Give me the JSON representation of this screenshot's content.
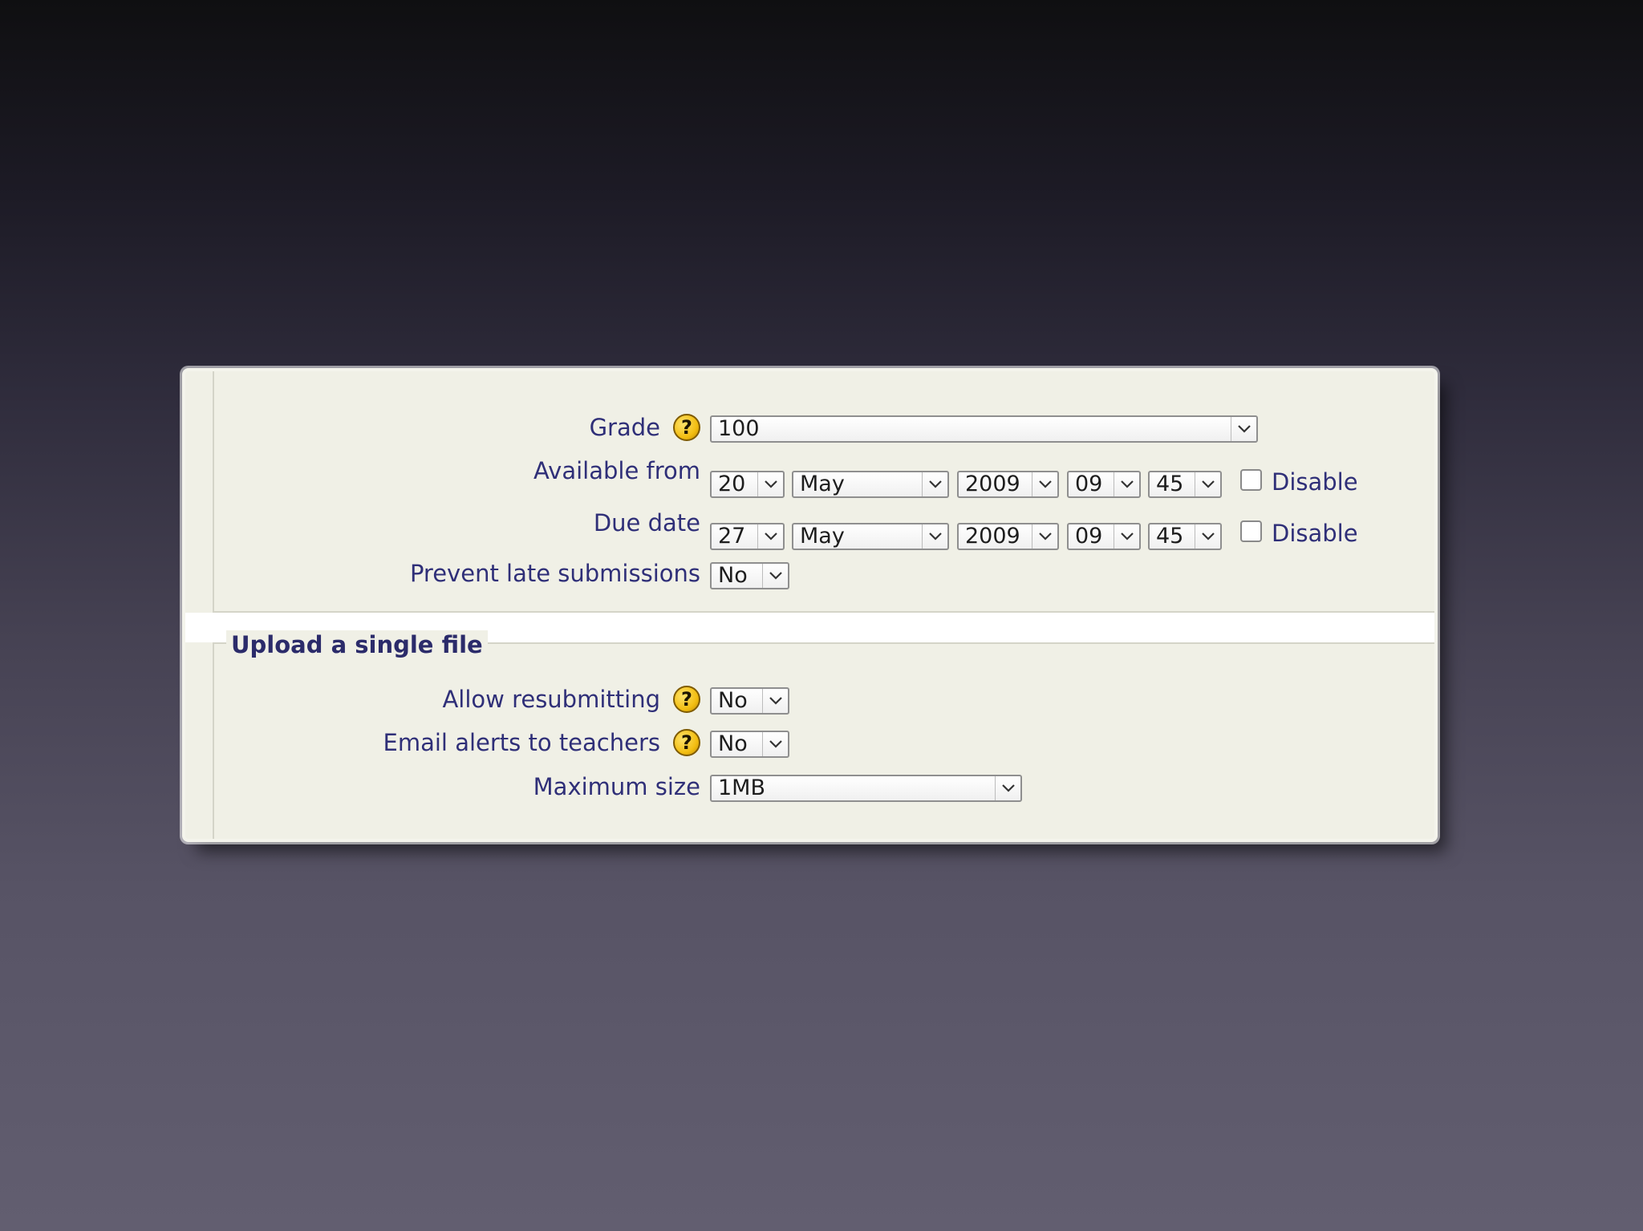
{
  "icons": {
    "help": "help-icon",
    "help_glyph": "?",
    "dropdown": "chevron-down-icon"
  },
  "colors": {
    "label": "#2f2f78",
    "legend": "#2b2b6a",
    "help_yellow": "#f2bd11",
    "panel": "#f0f0e6"
  },
  "form": {
    "grade": {
      "label": "Grade",
      "value": "100"
    },
    "available_from": {
      "label": "Available from",
      "day": "20",
      "month": "May",
      "year": "2009",
      "hour": "09",
      "minute": "45",
      "disable_label": "Disable",
      "disable_checked": false
    },
    "due_date": {
      "label": "Due date",
      "day": "27",
      "month": "May",
      "year": "2009",
      "hour": "09",
      "minute": "45",
      "disable_label": "Disable",
      "disable_checked": false
    },
    "prevent_late": {
      "label": "Prevent late submissions",
      "value": "No"
    },
    "upload_section": {
      "legend": "Upload a single file"
    },
    "allow_resubmitting": {
      "label": "Allow resubmitting",
      "value": "No"
    },
    "email_alerts": {
      "label": "Email alerts to teachers",
      "value": "No"
    },
    "maximum_size": {
      "label": "Maximum size",
      "value": "1MB"
    }
  }
}
